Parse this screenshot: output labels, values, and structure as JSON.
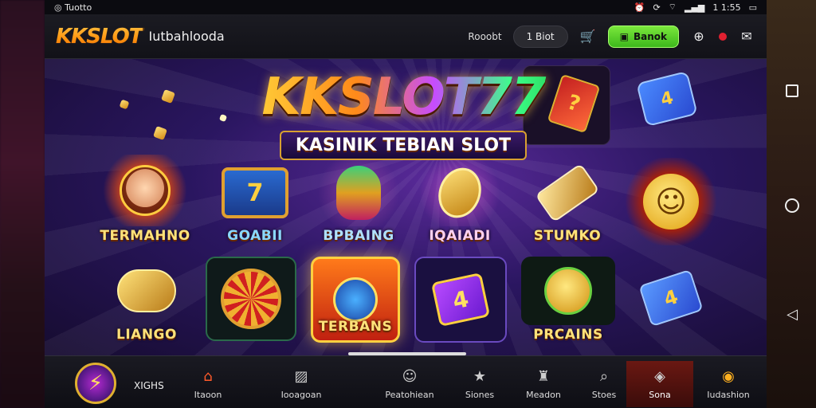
{
  "status_bar": {
    "left_text": "Tuotto",
    "right_text": "1 1:55"
  },
  "header": {
    "logo": "KKSLOT",
    "site_name": "Iutbahlooda",
    "link": "Rooobt",
    "pill_dark": "1 Biot",
    "pill_green": "Banok"
  },
  "banner": {
    "title": "KKSLOT77",
    "subtitle": "KASINIK TEBIAN SLOT"
  },
  "tiles": [
    {
      "label": "TERMAHNO"
    },
    {
      "label": "GOABII"
    },
    {
      "label": "BPBAING"
    },
    {
      "label": "IQAIADI"
    },
    {
      "label": "STUMKO"
    },
    {
      "label": "LIANGO"
    },
    {
      "label": ""
    },
    {
      "label": "TERBANS"
    },
    {
      "label": ""
    },
    {
      "label": "PRCAINS"
    }
  ],
  "bottom_nav": {
    "user_label": "XIGHS",
    "items": [
      {
        "label": "Itaoon",
        "icon": "home-icon"
      },
      {
        "label": "Iooagoan",
        "icon": "wallet-icon"
      },
      {
        "label": "Peatohiean",
        "icon": "message-icon"
      },
      {
        "label": "Siones",
        "icon": "star-icon"
      },
      {
        "label": "Meadon",
        "icon": "trophy-icon"
      },
      {
        "label": "Stoes",
        "icon": "search-icon"
      },
      {
        "label": "Sona",
        "icon": "gift-icon"
      },
      {
        "label": "Iudashion",
        "icon": "profile-icon"
      }
    ]
  }
}
